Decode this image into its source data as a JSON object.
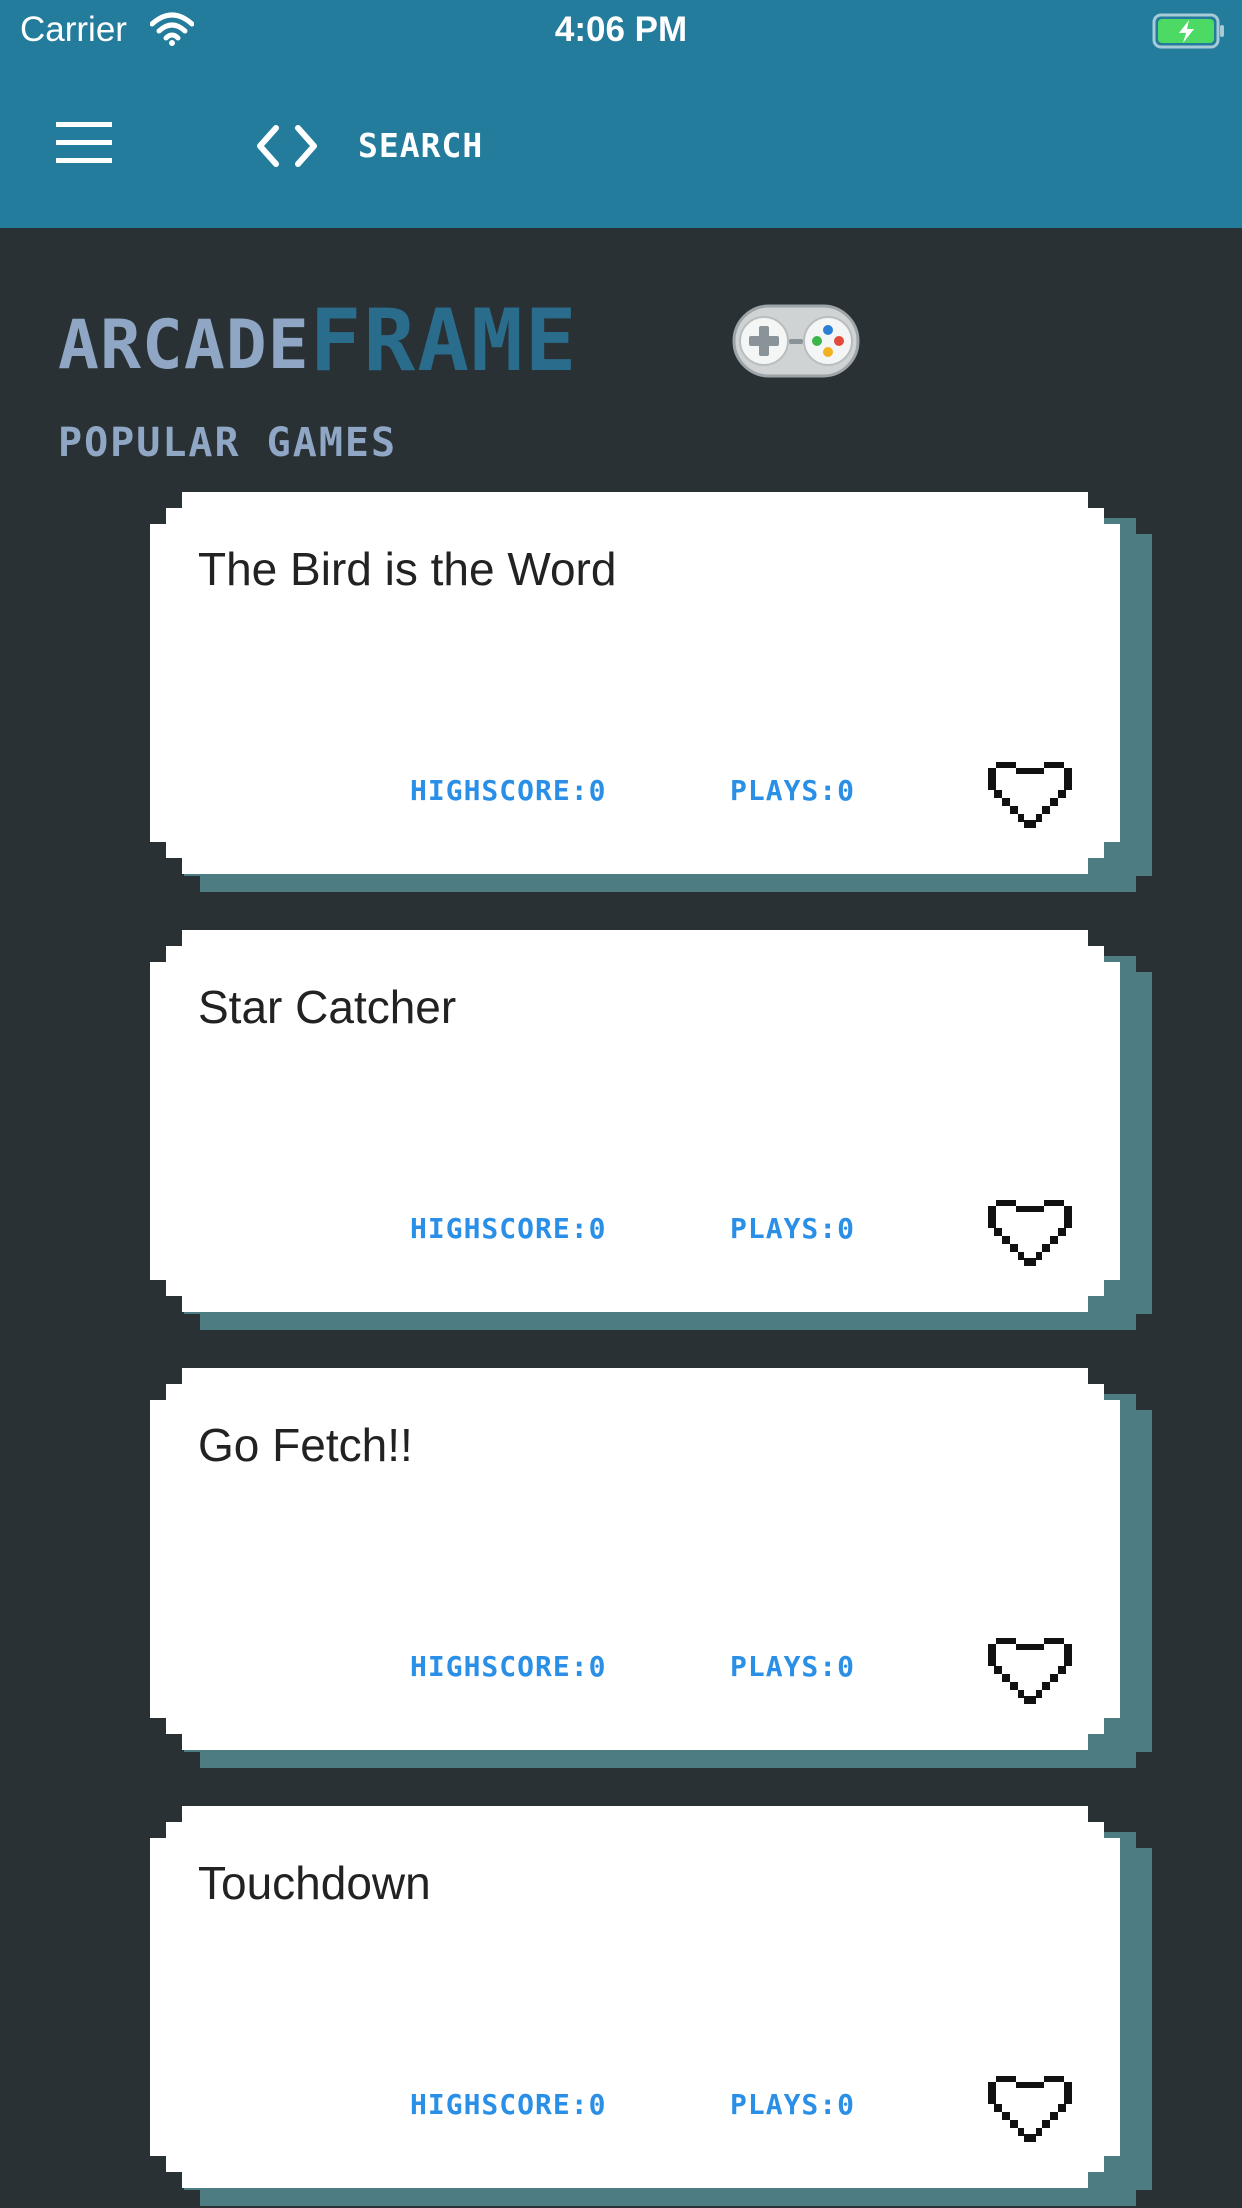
{
  "status_bar": {
    "carrier": "Carrier",
    "time": "4:06 PM",
    "wifi_icon": "wifi-icon",
    "battery_icon": "battery-charging-icon"
  },
  "nav": {
    "menu_icon": "hamburger-menu-icon",
    "code_icon": "code-brackets-icon",
    "search_label": "SEARCH"
  },
  "logo": {
    "part1": "ARCADE",
    "part2": "FRAME",
    "icon": "gamepad-icon"
  },
  "section": {
    "title": "POPULAR GAMES"
  },
  "colors": {
    "header": "#237c9b",
    "background": "#293134",
    "card": "#ffffff",
    "card_shadow": "#4e7c83",
    "stat_text": "#2a8fe6",
    "logo_light": "#8fa6c4",
    "logo_dark": "#2a6c8c"
  },
  "games": [
    {
      "title": "The Bird is the Word",
      "highscore": "HIGHSCORE:0",
      "plays": "PLAYS:0",
      "favorite_icon": "heart-outline-icon"
    },
    {
      "title": "Star Catcher",
      "highscore": "HIGHSCORE:0",
      "plays": "PLAYS:0",
      "favorite_icon": "heart-outline-icon"
    },
    {
      "title": "Go Fetch!!",
      "highscore": "HIGHSCORE:0",
      "plays": "PLAYS:0",
      "favorite_icon": "heart-outline-icon"
    },
    {
      "title": "Touchdown",
      "highscore": "HIGHSCORE:0",
      "plays": "PLAYS:0",
      "favorite_icon": "heart-outline-icon"
    }
  ]
}
